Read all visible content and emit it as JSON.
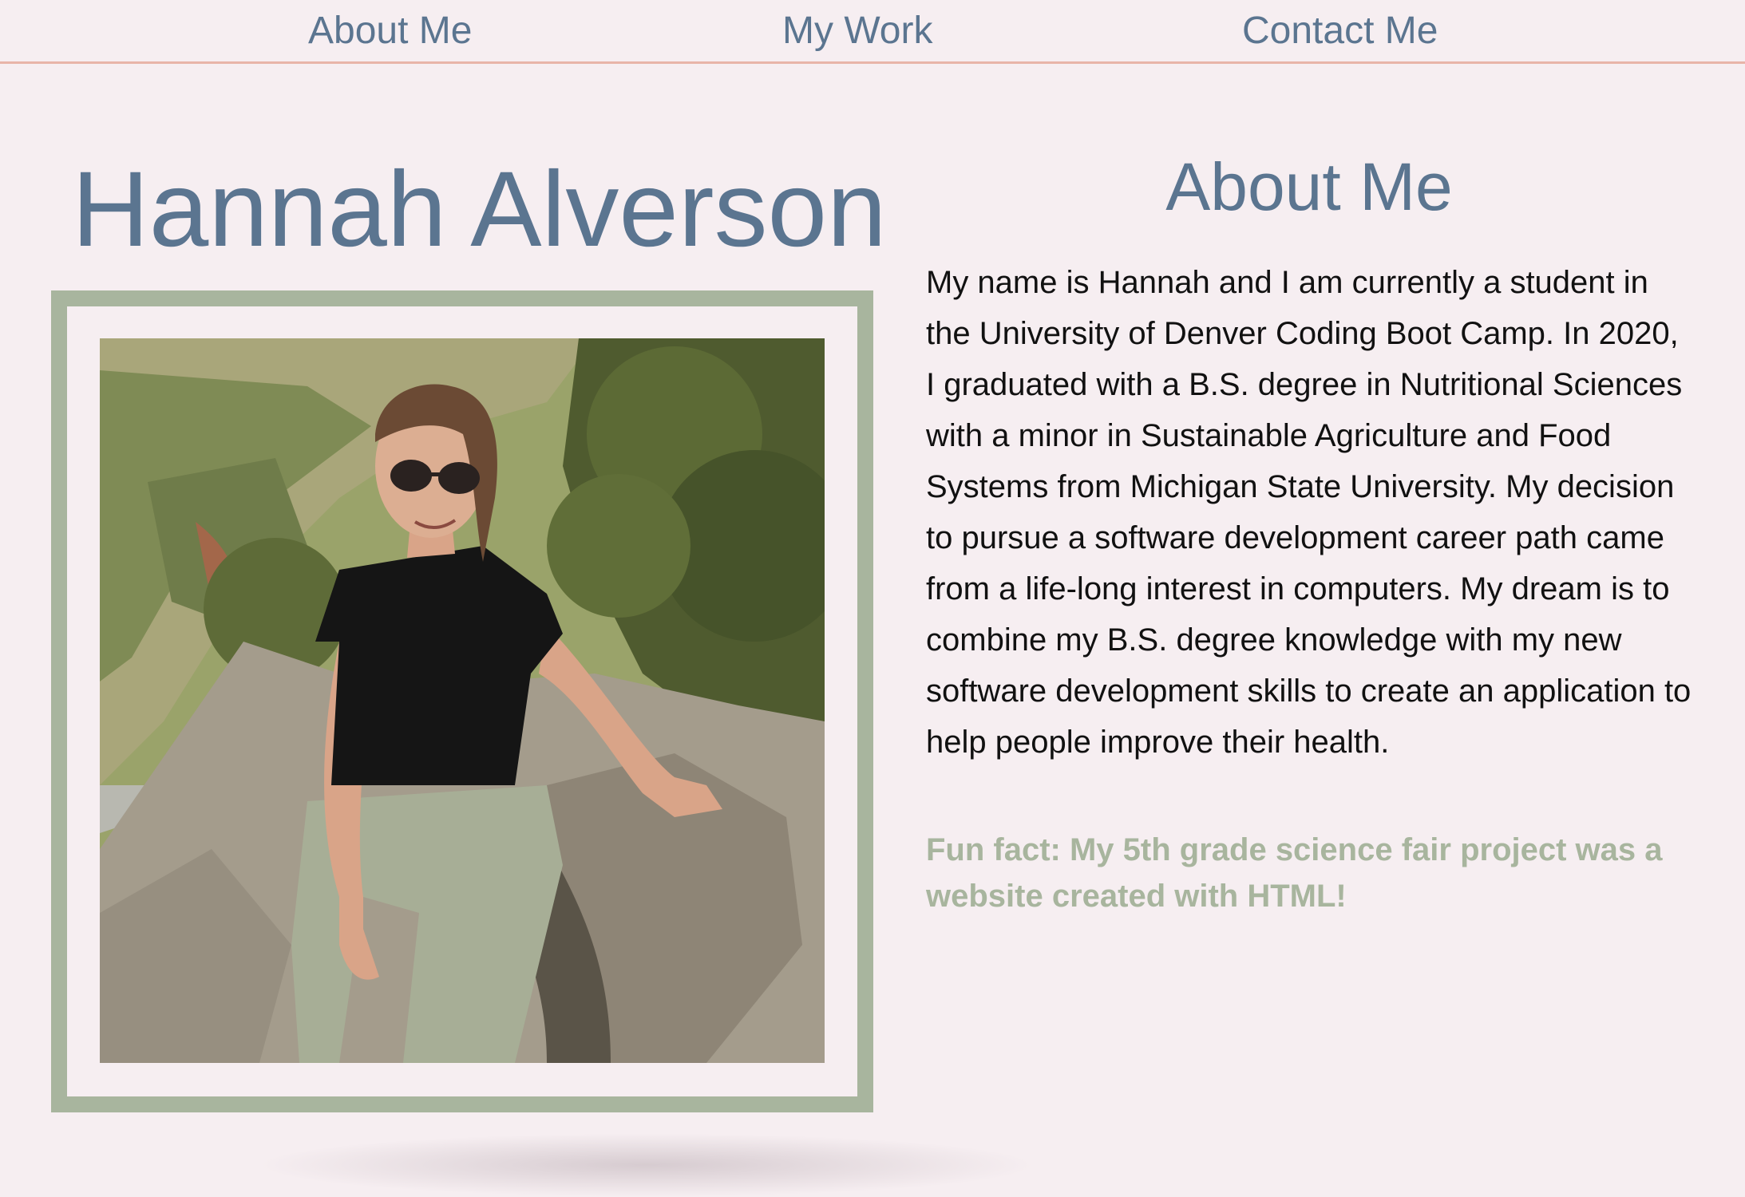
{
  "nav": {
    "about": "About Me",
    "work": "My Work",
    "contact": "Contact Me"
  },
  "header": {
    "name": "Hannah Alverson"
  },
  "about": {
    "title": "About Me",
    "bio": "My name is Hannah and I am currently a student in the University of Denver Coding Boot Camp. In 2020, I graduated with a B.S. degree in Nutritional Sciences with a minor in Sustainable Agriculture and Food Systems from Michigan State University. My decision to pursue a software development career path came from a life-long interest in computers. My dream is to combine my B.S. degree knowledge with my new software development skills to create an application to help people improve their health.",
    "fun_fact": "Fun fact: My 5th grade science fair project was a website created with HTML!"
  },
  "colors": {
    "background": "#f6eef1",
    "accent_blue": "#5b7590",
    "accent_sage": "#a8b59e",
    "nav_border": "#e8b4a8"
  },
  "icons": {
    "photo": "profile-photo"
  }
}
